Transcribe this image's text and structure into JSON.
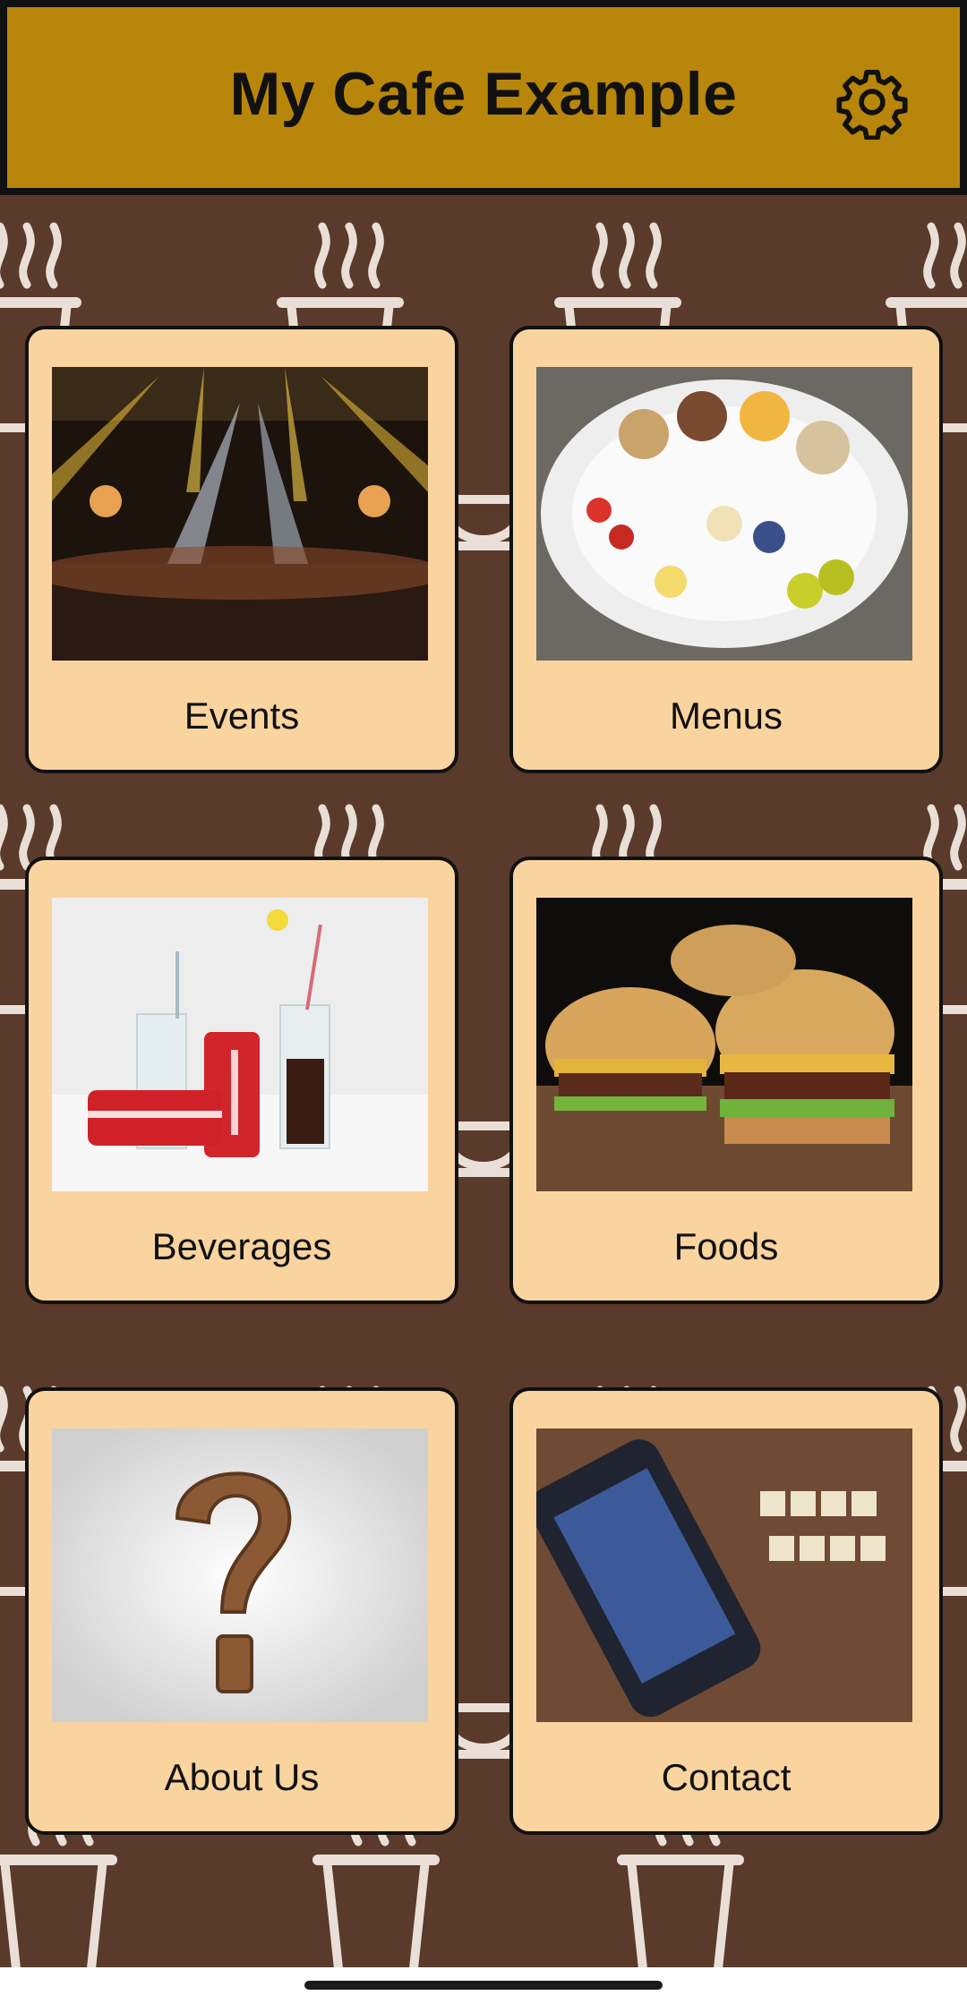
{
  "app": {
    "title": "My Cafe Example"
  },
  "header": {
    "settings_icon": "gear-icon"
  },
  "tiles": [
    {
      "label": "Events",
      "image": "concert-crowd-photo"
    },
    {
      "label": "Menus",
      "image": "snack-tray-photo"
    },
    {
      "label": "Beverages",
      "image": "cola-drinks-photo"
    },
    {
      "label": "Foods",
      "image": "burgers-photo"
    },
    {
      "label": "About Us",
      "image": "question-mark-photo"
    },
    {
      "label": "Contact",
      "image": "social-media-phone-photo"
    }
  ],
  "colors": {
    "header_bg": "#b8860b",
    "background": "#5a3a2b",
    "card_bg": "#f9d49f"
  }
}
